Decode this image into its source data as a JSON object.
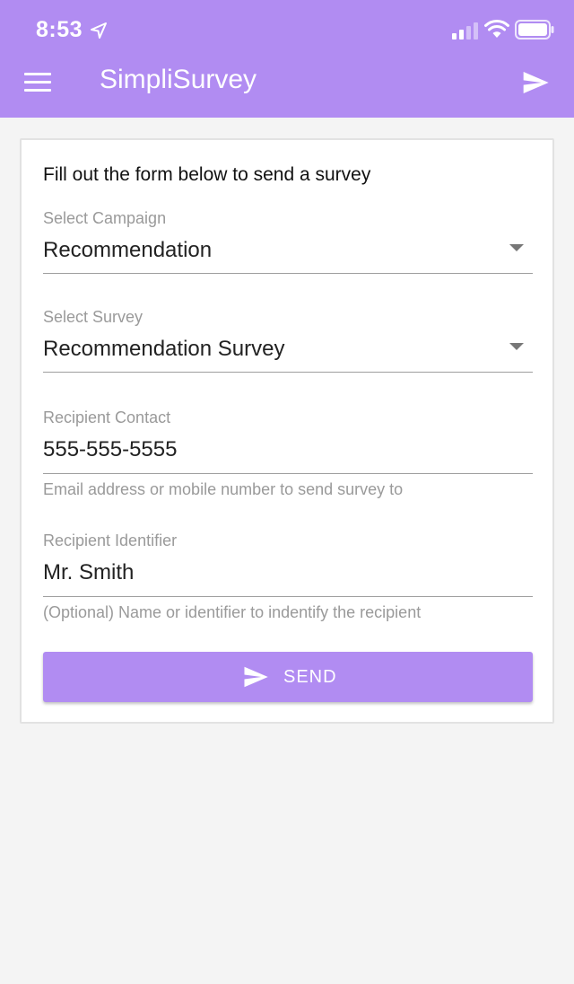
{
  "status_bar": {
    "time": "8:53",
    "icons": [
      "location-arrow-icon",
      "signal-icon",
      "wifi-icon",
      "battery-icon"
    ]
  },
  "app_bar": {
    "title": "SimpliSurvey",
    "menu_icon": "hamburger-menu-icon",
    "action_icon": "send-icon"
  },
  "form": {
    "intro": "Fill out the form below to send a survey",
    "campaign": {
      "label": "Select Campaign",
      "value": "Recommendation"
    },
    "survey": {
      "label": "Select Survey",
      "value": "Recommendation Survey"
    },
    "contact": {
      "label": "Recipient Contact",
      "value": "555-555-5555",
      "helper": "Email address or mobile number to send survey to"
    },
    "identifier": {
      "label": "Recipient Identifier",
      "value": "Mr. Smith",
      "helper": "(Optional) Name or identifier to indentify the recipient"
    },
    "send_label": "SEND"
  },
  "colors": {
    "primary": "#b18cf2",
    "background": "#f4f4f4",
    "card": "#ffffff",
    "label": "#9a9a9a"
  }
}
